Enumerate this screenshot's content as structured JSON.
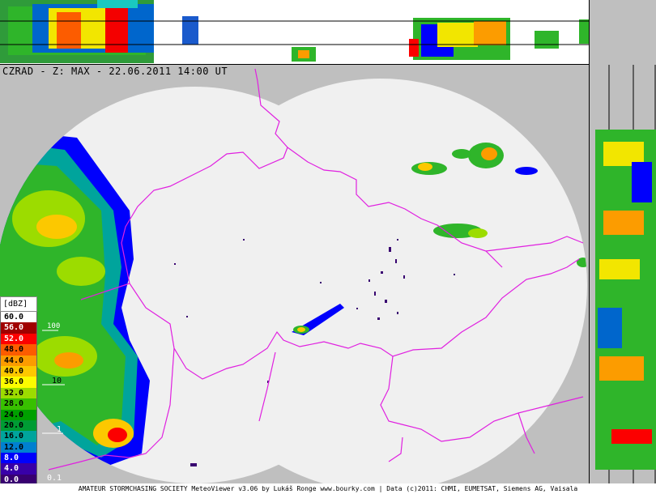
{
  "header": {
    "title": "CZRAD - Z: MAX - 22.06.2011 14:00 UT"
  },
  "legend": {
    "unit": "[dBZ]",
    "entries": [
      {
        "label": "60.0",
        "color": "#ffffff",
        "text": "#000000"
      },
      {
        "label": "56.0",
        "color": "#a00000",
        "text": "#ffffff"
      },
      {
        "label": "52.0",
        "color": "#fc0000",
        "text": "#ffffff"
      },
      {
        "label": "48.0",
        "color": "#fc5c00",
        "text": "#000000"
      },
      {
        "label": "44.0",
        "color": "#fc9c00",
        "text": "#000000"
      },
      {
        "label": "40.0",
        "color": "#fcc800",
        "text": "#000000"
      },
      {
        "label": "36.0",
        "color": "#fcfc00",
        "text": "#000000"
      },
      {
        "label": "32.0",
        "color": "#9cdc00",
        "text": "#000000"
      },
      {
        "label": "28.0",
        "color": "#38c000",
        "text": "#000000"
      },
      {
        "label": "24.0",
        "color": "#00a000",
        "text": "#000000"
      },
      {
        "label": "20.0",
        "color": "#009c34",
        "text": "#000000"
      },
      {
        "label": "16.0",
        "color": "#00a49c",
        "text": "#000000"
      },
      {
        "label": "12.0",
        "color": "#0080d0",
        "text": "#000000"
      },
      {
        "label": "8.0",
        "color": "#0000fc",
        "text": "#ffffff"
      },
      {
        "label": "4.0",
        "color": "#3800a8",
        "text": "#ffffff"
      },
      {
        "label": "0.0",
        "color": "#380070",
        "text": "#ffffff"
      }
    ]
  },
  "scale_labels": [
    "100",
    "10",
    "1",
    "0.1"
  ],
  "footer": "AMATEUR STORMCHASING SOCIETY MeteoViewer v3.06 by Lukáš Ronge www.bourky.com | Data (c)2011: CHMI, EUMETSAT, Siemens AG, Vaisala",
  "colors": {
    "background": "#bfbfbf",
    "coverage": "#f0f0f0",
    "border": "#e020e0"
  }
}
